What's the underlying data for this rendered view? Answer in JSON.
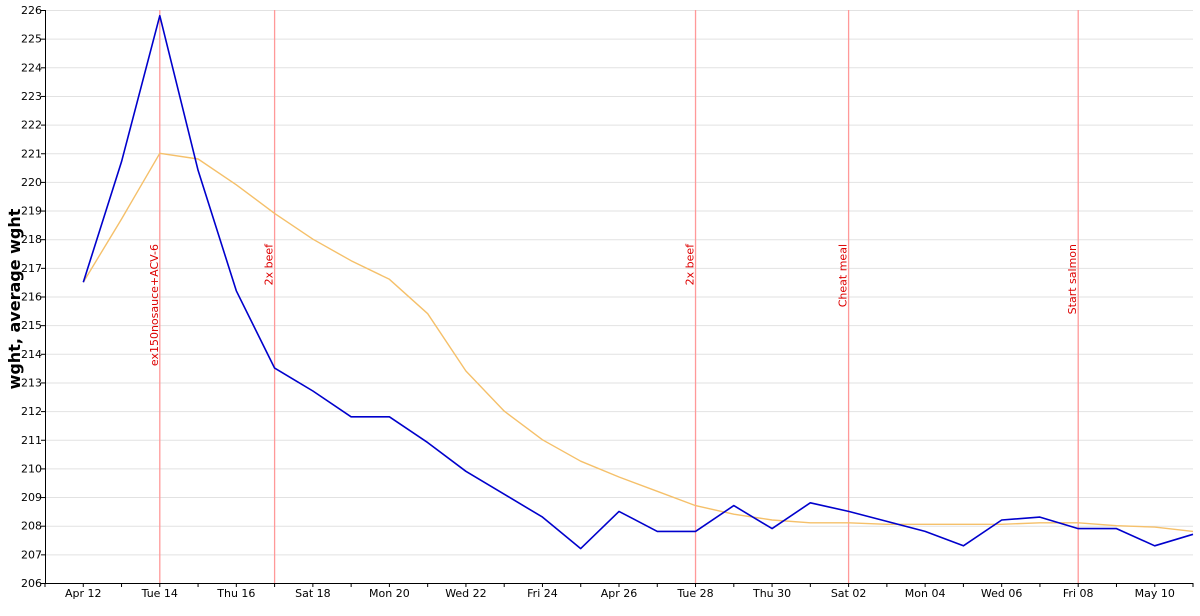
{
  "chart_data": {
    "type": "line",
    "title": "",
    "xlabel": "",
    "ylabel": "wght, average wght",
    "ylim": [
      206,
      226
    ],
    "yticks": [
      206,
      207,
      208,
      209,
      210,
      211,
      212,
      213,
      214,
      215,
      216,
      217,
      218,
      219,
      220,
      221,
      222,
      223,
      224,
      225,
      226
    ],
    "xlim": [
      "2021-04-11",
      "2021-05-11"
    ],
    "xticks": [
      {
        "date": "2021-04-12",
        "label": "Apr 12"
      },
      {
        "date": "2021-04-14",
        "label": "Tue 14"
      },
      {
        "date": "2021-04-16",
        "label": "Thu 16"
      },
      {
        "date": "2021-04-18",
        "label": "Sat 18"
      },
      {
        "date": "2021-04-20",
        "label": "Mon 20"
      },
      {
        "date": "2021-04-22",
        "label": "Wed 22"
      },
      {
        "date": "2021-04-24",
        "label": "Fri 24"
      },
      {
        "date": "2021-04-26",
        "label": "Apr 26"
      },
      {
        "date": "2021-04-28",
        "label": "Tue 28"
      },
      {
        "date": "2021-04-30",
        "label": "Thu 30"
      },
      {
        "date": "2021-05-02",
        "label": "Sat 02"
      },
      {
        "date": "2021-05-04",
        "label": "Mon 04"
      },
      {
        "date": "2021-05-06",
        "label": "Wed 06"
      },
      {
        "date": "2021-05-08",
        "label": "Fri 08"
      },
      {
        "date": "2021-05-10",
        "label": "May 10"
      }
    ],
    "grid": true,
    "series": [
      {
        "key": "wght",
        "color": "#0000cc",
        "points": [
          [
            "2021-04-12",
            216.5
          ],
          [
            "2021-04-13",
            220.7
          ],
          [
            "2021-04-14",
            225.8
          ],
          [
            "2021-04-15",
            220.4
          ],
          [
            "2021-04-16",
            216.2
          ],
          [
            "2021-04-17",
            213.5
          ],
          [
            "2021-04-18",
            212.7
          ],
          [
            "2021-04-19",
            211.8
          ],
          [
            "2021-04-20",
            211.8
          ],
          [
            "2021-04-21",
            210.9
          ],
          [
            "2021-04-22",
            209.9
          ],
          [
            "2021-04-23",
            209.1
          ],
          [
            "2021-04-24",
            208.3
          ],
          [
            "2021-04-25",
            207.2
          ],
          [
            "2021-04-26",
            208.5
          ],
          [
            "2021-04-27",
            207.8
          ],
          [
            "2021-04-28",
            207.8
          ],
          [
            "2021-04-29",
            208.7
          ],
          [
            "2021-04-30",
            207.9
          ],
          [
            "2021-05-01",
            208.8
          ],
          [
            "2021-05-02",
            208.5
          ],
          [
            "2021-05-03",
            208.15
          ],
          [
            "2021-05-04",
            207.8
          ],
          [
            "2021-05-05",
            207.3
          ],
          [
            "2021-05-06",
            208.2
          ],
          [
            "2021-05-07",
            208.3
          ],
          [
            "2021-05-08",
            207.9
          ],
          [
            "2021-05-09",
            207.9
          ],
          [
            "2021-05-10",
            207.3
          ],
          [
            "2021-05-11",
            207.7
          ]
        ]
      },
      {
        "key": "average wght",
        "color": "#f5c06a",
        "points": [
          [
            "2021-04-12",
            216.5
          ],
          [
            "2021-04-13",
            218.7
          ],
          [
            "2021-04-14",
            221.0
          ],
          [
            "2021-04-15",
            220.8
          ],
          [
            "2021-04-16",
            219.9
          ],
          [
            "2021-04-17",
            218.9
          ],
          [
            "2021-04-18",
            218.0
          ],
          [
            "2021-04-19",
            217.25
          ],
          [
            "2021-04-20",
            216.6
          ],
          [
            "2021-04-21",
            215.4
          ],
          [
            "2021-04-22",
            213.4
          ],
          [
            "2021-04-23",
            212.0
          ],
          [
            "2021-04-24",
            211.0
          ],
          [
            "2021-04-25",
            210.25
          ],
          [
            "2021-04-26",
            209.7
          ],
          [
            "2021-04-27",
            209.2
          ],
          [
            "2021-04-28",
            208.7
          ],
          [
            "2021-04-29",
            208.4
          ],
          [
            "2021-04-30",
            208.2
          ],
          [
            "2021-05-01",
            208.1
          ],
          [
            "2021-05-02",
            208.1
          ],
          [
            "2021-05-03",
            208.05
          ],
          [
            "2021-05-04",
            208.05
          ],
          [
            "2021-05-05",
            208.05
          ],
          [
            "2021-05-06",
            208.05
          ],
          [
            "2021-05-07",
            208.1
          ],
          [
            "2021-05-08",
            208.1
          ],
          [
            "2021-05-09",
            208.0
          ],
          [
            "2021-05-10",
            207.95
          ],
          [
            "2021-05-11",
            207.8
          ]
        ]
      }
    ],
    "annotations": [
      {
        "date": "2021-04-14",
        "label": "ex150nosauce+ACV-6",
        "color": "#ff9999",
        "text_color": "#dd0000"
      },
      {
        "date": "2021-04-17",
        "label": "2x beef",
        "color": "#ff9999",
        "text_color": "#dd0000"
      },
      {
        "date": "2021-04-28",
        "label": "2x beef",
        "color": "#ff9999",
        "text_color": "#dd0000"
      },
      {
        "date": "2021-05-02",
        "label": "Cheat meal",
        "color": "#ff9999",
        "text_color": "#dd0000"
      },
      {
        "date": "2021-05-08",
        "label": "Start salmon",
        "color": "#ff9999",
        "text_color": "#dd0000"
      }
    ]
  }
}
